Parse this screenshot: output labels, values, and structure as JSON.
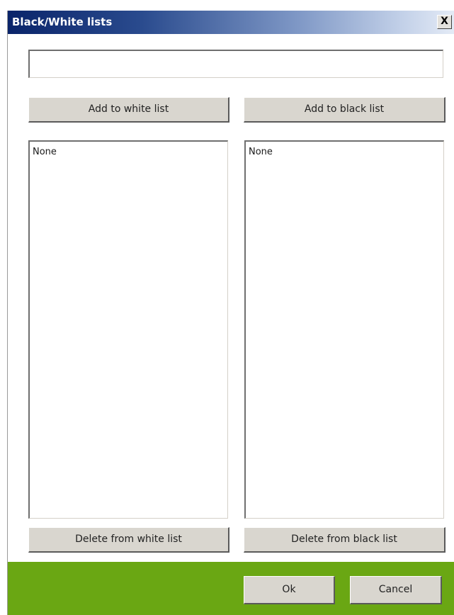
{
  "window": {
    "title": "Black/White lists",
    "close_glyph": "X"
  },
  "input": {
    "value": "",
    "placeholder": ""
  },
  "buttons": {
    "add_white": "Add to white list",
    "add_black": "Add to black list",
    "delete_white": "Delete from white list",
    "delete_black": "Delete from black list",
    "ok": "Ok",
    "cancel": "Cancel"
  },
  "lists": {
    "white": {
      "items": [
        "None"
      ]
    },
    "black": {
      "items": [
        "None"
      ]
    }
  },
  "colors": {
    "titlebar_start": "#0a246a",
    "titlebar_end": "#e4ebf6",
    "footer": "#6aa713",
    "button_face": "#d9d6cf"
  }
}
